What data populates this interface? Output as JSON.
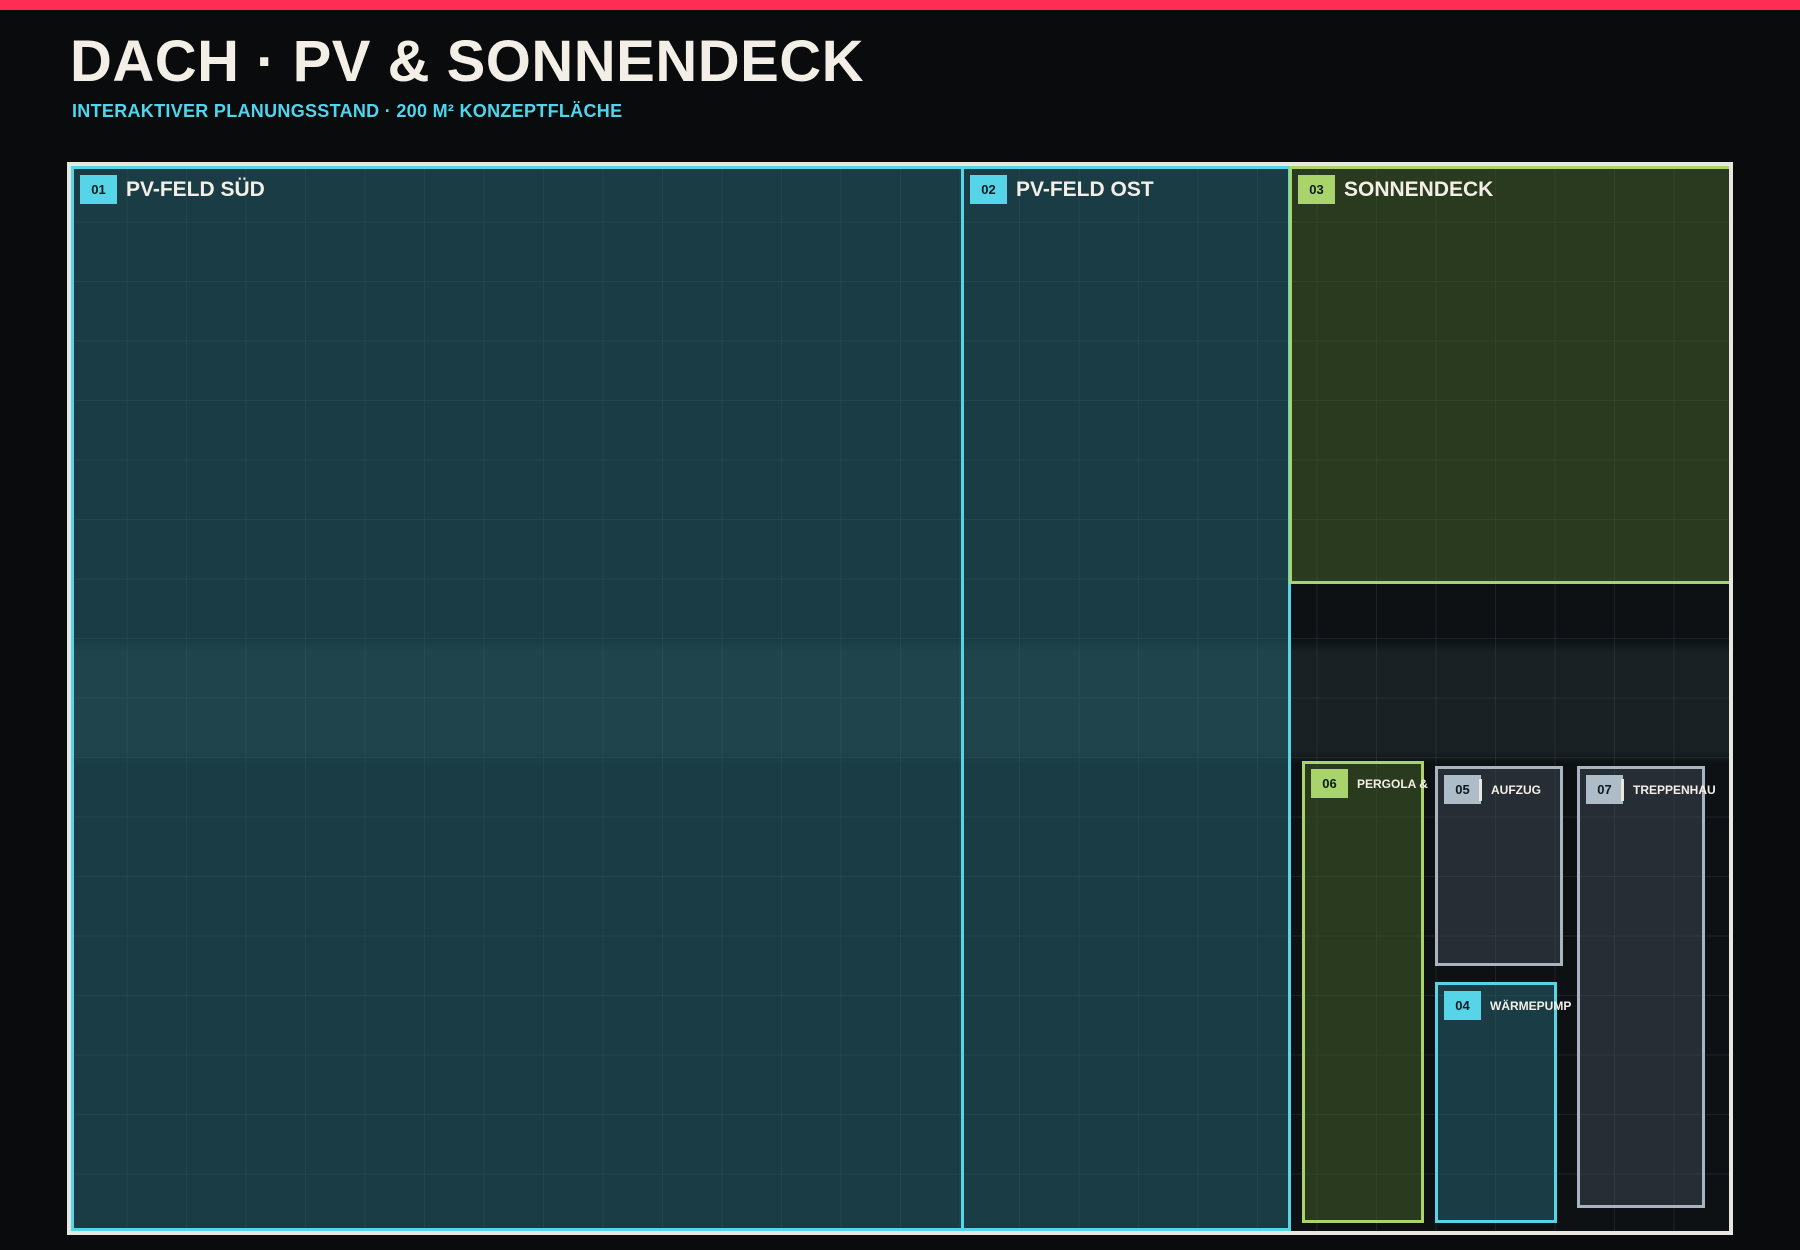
{
  "header": {
    "title": "DACH · PV & SONNENDECK",
    "subtitle": "INTERAKTIVER PLANUNGSSTAND · 200 M² KONZEPTFLÄCHE"
  },
  "colors": {
    "accent_bar": "#ff2d55",
    "pv": "#56d4e8",
    "green": "#a9d46c",
    "grey": "#a9b4c0"
  },
  "zones": [
    {
      "num": "01",
      "label": "PV-FELD SÜD"
    },
    {
      "num": "02",
      "label": "PV-FELD OST"
    },
    {
      "num": "03",
      "label": "SONNENDECK"
    },
    {
      "num": "04",
      "label": "WÄRMEPUMP"
    },
    {
      "num": "05",
      "label": "AUFZUG"
    },
    {
      "num": "06",
      "label": "PERGOLA &"
    },
    {
      "num": "07",
      "label": "TREPPENHAU"
    }
  ]
}
